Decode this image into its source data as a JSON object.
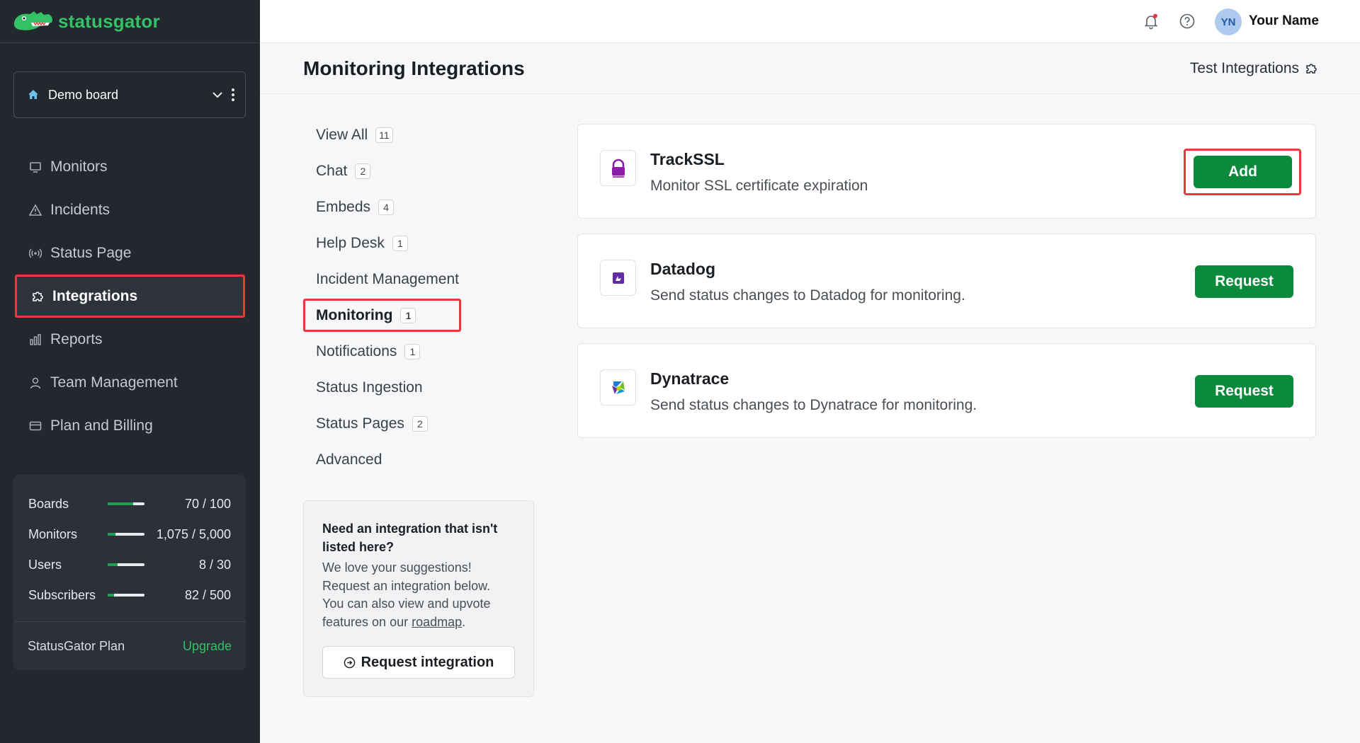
{
  "brand": {
    "name": "statusgator"
  },
  "board": {
    "label": "Demo board"
  },
  "sidebar": {
    "items": [
      {
        "label": "Monitors",
        "icon": "monitor-icon"
      },
      {
        "label": "Incidents",
        "icon": "warning-icon"
      },
      {
        "label": "Status Page",
        "icon": "broadcast-icon"
      },
      {
        "label": "Integrations",
        "icon": "puzzle-icon"
      },
      {
        "label": "Reports",
        "icon": "bar-chart-icon"
      },
      {
        "label": "Team Management",
        "icon": "user-icon"
      },
      {
        "label": "Plan and Billing",
        "icon": "credit-card-icon"
      }
    ]
  },
  "usage": {
    "rows": [
      {
        "label": "Boards",
        "value": "70 / 100",
        "fraction": 0.7
      },
      {
        "label": "Monitors",
        "value": "1,075 / 5,000",
        "fraction": 0.215
      },
      {
        "label": "Users",
        "value": "8 / 30",
        "fraction": 0.267
      },
      {
        "label": "Subscribers",
        "value": "82 / 500",
        "fraction": 0.164
      }
    ],
    "plan_label": "StatusGator Plan",
    "upgrade_label": "Upgrade"
  },
  "user": {
    "initials": "YN",
    "name": "Your Name"
  },
  "page": {
    "title": "Monitoring Integrations",
    "test_link": "Test Integrations"
  },
  "categories": [
    {
      "label": "View All",
      "count": "11"
    },
    {
      "label": "Chat",
      "count": "2"
    },
    {
      "label": "Embeds",
      "count": "4"
    },
    {
      "label": "Help Desk",
      "count": "1"
    },
    {
      "label": "Incident Management",
      "count": ""
    },
    {
      "label": "Monitoring",
      "count": "1"
    },
    {
      "label": "Notifications",
      "count": "1"
    },
    {
      "label": "Status Ingestion",
      "count": ""
    },
    {
      "label": "Status Pages",
      "count": "2"
    },
    {
      "label": "Advanced",
      "count": ""
    }
  ],
  "suggest": {
    "title": "Need an integration that isn't listed here?",
    "body_1": "We love your suggestions! Request an integration below. You can also view and upvote features on our ",
    "link": "roadmap",
    "body_2": ".",
    "button": "Request integration"
  },
  "integrations": [
    {
      "name": "TrackSSL",
      "description": "Monitor SSL certificate expiration",
      "button": "Add"
    },
    {
      "name": "Datadog",
      "description": "Send status changes to Datadog for monitoring.",
      "button": "Request"
    },
    {
      "name": "Dynatrace",
      "description": "Send status changes to Dynatrace for monitoring.",
      "button": "Request"
    }
  ],
  "colors": {
    "accent_green": "#0b8a3c",
    "brand_green": "#34c064",
    "highlight_red": "#e83a3a",
    "sidebar_bg": "#23272e"
  }
}
